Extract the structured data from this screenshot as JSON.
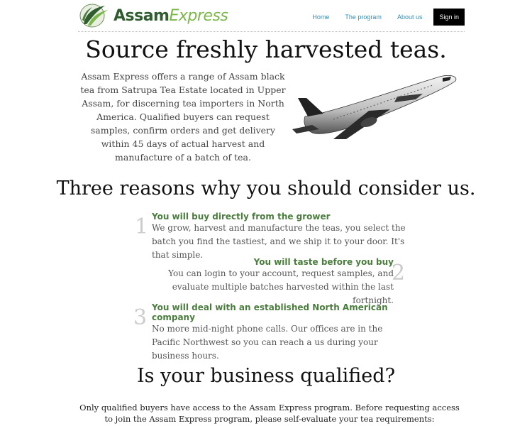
{
  "header": {
    "logo_part1": "Assam",
    "logo_part2": "Express",
    "nav": [
      "Home",
      "The program",
      "About us"
    ],
    "signin_label": "Sign in"
  },
  "hero": {
    "title": "Source freshly harvested teas.",
    "text": "Assam Express offers a range of Assam black tea from Satrupa Tea Estate located in Upper Assam, for discerning tea importers in North America. Qualified buyers can request samples, confirm orders and get delivery within 45 days of actual harvest and manufacture of a batch of tea."
  },
  "reasons": {
    "heading": "Three reasons why you should consider us.",
    "items": [
      {
        "number": "1",
        "title": "You will buy directly from the grower",
        "text": "We grow, harvest and manufacture the teas, you select the batch you find the tastiest, and we ship it to your door. It's that simple."
      },
      {
        "number": "2",
        "title": "You will taste before you buy",
        "text": "You can login to your account, request samples, and evaluate multiple batches harvested within the last fortnight."
      },
      {
        "number": "3",
        "title": "You will deal with an established North American company",
        "text": "No more mid-night phone calls. Our offices are in the Pacific Northwest so you can reach a us during your business hours."
      }
    ]
  },
  "qualified": {
    "heading": "Is your business qualified?",
    "text": "Only qualified buyers have access to the Assam Express program. Before requesting access to join the Assam Express program, please self-evaluate your tea requirements:"
  },
  "colors": {
    "logo_dark": "#2f5d2f",
    "logo_light": "#7ab648",
    "nav_link": "#2e8fb6",
    "reason_title": "#4a7d3d"
  }
}
